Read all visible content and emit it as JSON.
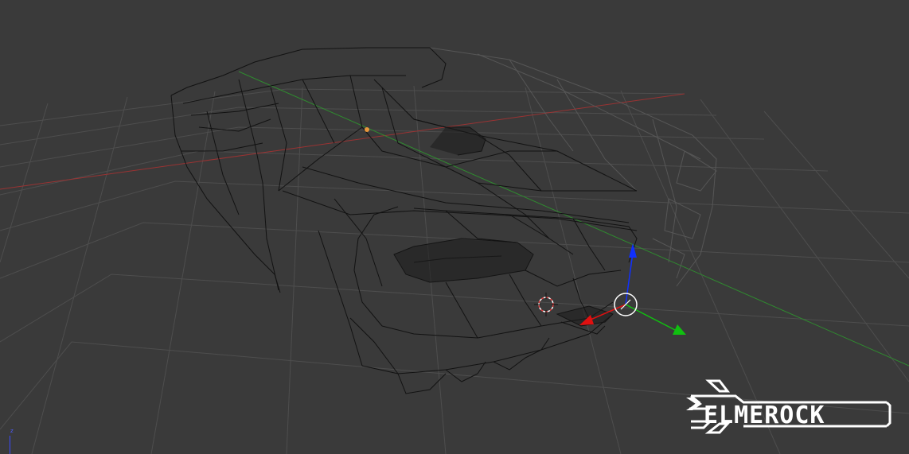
{
  "viewport": {
    "view": "3d-perspective",
    "shading": "wireframe",
    "background_color": "#3a3a3a",
    "grid_color": "#505050",
    "x_axis_color": "#b53a3a",
    "y_axis_color": "#3aa03a",
    "wire_color": "#111111",
    "selection_origin_color": "#e8963c"
  },
  "gizmo": {
    "x_color": "#e01010",
    "y_color": "#10c010",
    "z_color": "#1030ff",
    "center_ring_color": "#ffffff",
    "cursor_color": "#e04040"
  },
  "axis_indicator": {
    "label": "z",
    "color": "#4d5cff"
  },
  "logo": {
    "text": "ELMEROCK",
    "color": "#ffffff"
  }
}
